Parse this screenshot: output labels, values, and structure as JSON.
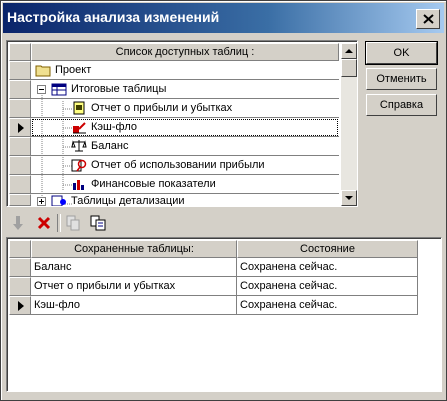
{
  "window": {
    "title": "Настройка анализа изменений"
  },
  "buttons": {
    "ok": "OK",
    "cancel": "Отменить",
    "help": "Справка"
  },
  "available": {
    "header": "Список доступных таблиц :",
    "items": [
      {
        "label": "Проект",
        "icon": "folder-icon"
      },
      {
        "label": "Итоговые таблицы",
        "icon": "table-icon"
      },
      {
        "label": "Отчет о прибыли и убытках",
        "icon": "report-icon"
      },
      {
        "label": "Кэш-фло",
        "icon": "cashflow-icon"
      },
      {
        "label": "Баланс",
        "icon": "balance-icon"
      },
      {
        "label": "Отчет об использовании прибыли",
        "icon": "profit-usage-icon"
      },
      {
        "label": "Финансовые показатели",
        "icon": "financial-indicators-icon"
      },
      {
        "label": "Таблицы детализации",
        "icon": "detail-tables-icon"
      }
    ]
  },
  "saved": {
    "col_name": "Сохраненные таблицы:",
    "col_state": "Состояние",
    "rows": [
      {
        "name": "Баланс",
        "state": "Сохранена сейчас."
      },
      {
        "name": "Отчет о прибыли и убытках",
        "state": "Сохранена сейчас."
      },
      {
        "name": "Кэш-фло",
        "state": "Сохранена сейчас."
      }
    ]
  },
  "colors": {
    "title_start": "#0a246a",
    "title_end": "#a6caf0",
    "face": "#d4d0c8"
  }
}
